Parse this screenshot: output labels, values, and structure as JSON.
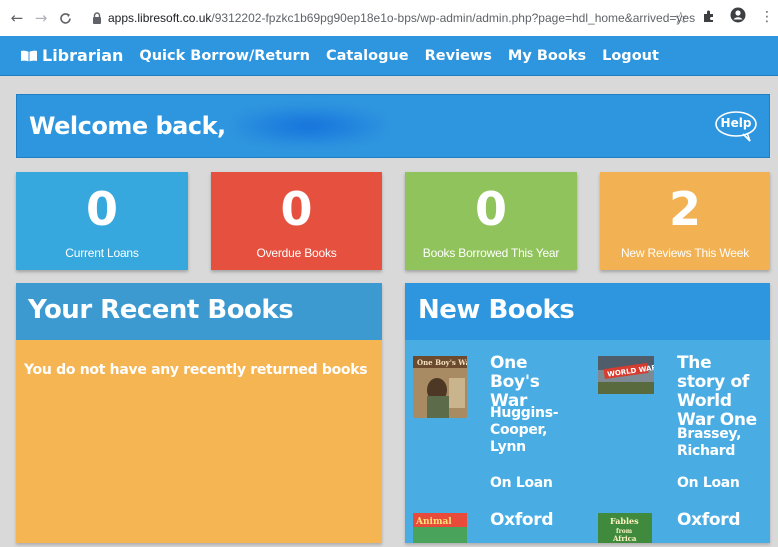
{
  "browser": {
    "url_host": "apps.libresoft.co.uk",
    "url_path": "/9312202-fpzkc1b69pg90ep18e1o-bps/wp-admin/admin.php?page=hdl_home&arrived=yes"
  },
  "nav": {
    "brand": "Librarian",
    "links": [
      "Quick Borrow/Return",
      "Catalogue",
      "Reviews",
      "My Books",
      "Logout"
    ]
  },
  "welcome": {
    "text": "Welcome back,",
    "help_label": "Help"
  },
  "stats": [
    {
      "value": "0",
      "label": "Current Loans",
      "color": "#36a8de"
    },
    {
      "value": "0",
      "label": "Overdue Books",
      "color": "#e6513f"
    },
    {
      "value": "0",
      "label": "Books Borrowed This Year",
      "color": "#90c35c"
    },
    {
      "value": "2",
      "label": "New Reviews This Week",
      "color": "#f2b253"
    }
  ],
  "recent": {
    "title": "Your Recent Books",
    "message": "You do not have any recently returned books"
  },
  "new_books": {
    "title": "New Books",
    "items": [
      {
        "title": "One Boy's War",
        "author": "Huggins-Cooper, Lynn",
        "status": "On Loan"
      },
      {
        "title": "The story of World War One",
        "author": "Brassey, Richard",
        "status": "On Loan"
      },
      {
        "title": "Oxford",
        "author": "",
        "status": ""
      },
      {
        "title": "Oxford",
        "author": "",
        "status": ""
      }
    ]
  }
}
